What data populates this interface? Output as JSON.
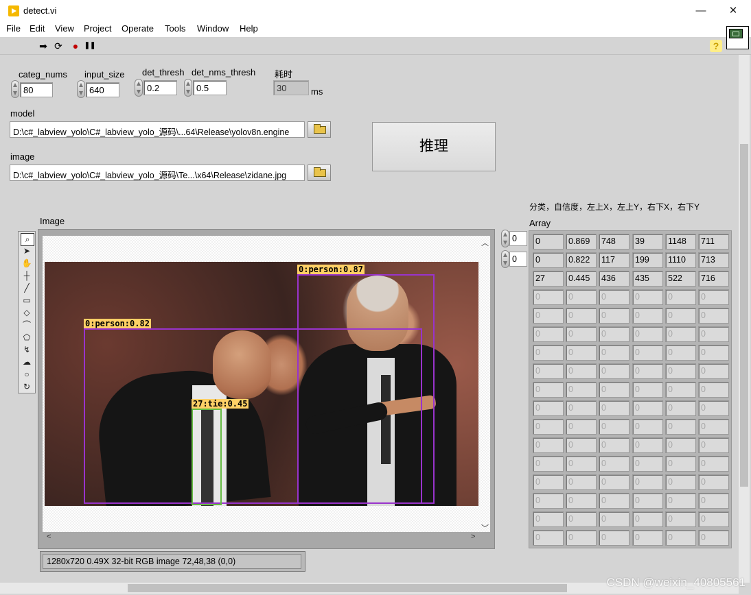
{
  "window": {
    "title": "detect.vi",
    "minimize": "—",
    "maximize": "☐",
    "close": "✕"
  },
  "menu": [
    "File",
    "Edit",
    "View",
    "Project",
    "Operate",
    "Tools",
    "Window",
    "Help"
  ],
  "toolbar": {
    "run": "➡",
    "run_continuous": "⟳",
    "abort": "●",
    "pause": "❚❚",
    "help": "?"
  },
  "controls": {
    "categ_nums": {
      "label": "categ_nums",
      "value": "80"
    },
    "input_size": {
      "label": "input_size",
      "value": "640"
    },
    "det_thresh": {
      "label": "det_thresh",
      "value": "0.2"
    },
    "det_nms_thresh": {
      "label": "det_nms_thresh",
      "value": "0.5"
    },
    "elapsed": {
      "label": "耗时",
      "value": "30",
      "unit": "ms"
    },
    "model": {
      "label": "model",
      "path": "D:\\c#_labview_yolo\\C#_labview_yolo_源码\\...64\\Release\\yolov8n.engine"
    },
    "image": {
      "label": "image",
      "path": "D:\\c#_labview_yolo\\C#_labview_yolo_源码\\Te...\\x64\\Release\\zidane.jpg"
    },
    "infer_button": "推理"
  },
  "image_display": {
    "label": "Image",
    "detections": [
      {
        "label": "0:person:0.87",
        "color": "#9933cc"
      },
      {
        "label": "0:person:0.82",
        "color": "#9933cc"
      },
      {
        "label": "27:tie:0.45",
        "color": "#66bb44"
      }
    ],
    "status": "1280x720 0.49X 32-bit RGB image 72,48,38     (0,0)"
  },
  "array": {
    "caption": "分类，自信度，左上X，左上Y，右下X，右下Y",
    "label": "Array",
    "index_row": "0",
    "index_col": "0",
    "rows": [
      [
        "0",
        "0.869",
        "748",
        "39",
        "1148",
        "711"
      ],
      [
        "0",
        "0.822",
        "117",
        "199",
        "1110",
        "713"
      ],
      [
        "27",
        "0.445",
        "436",
        "435",
        "522",
        "716"
      ]
    ],
    "empty_value": "0"
  },
  "watermark": "CSDN @weixin_40805561"
}
